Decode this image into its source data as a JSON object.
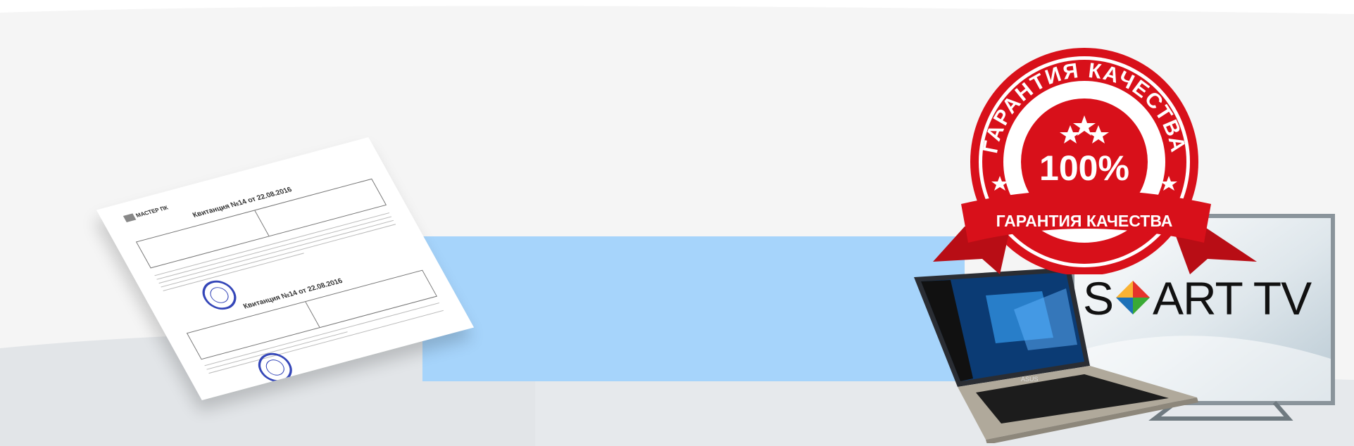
{
  "receipt": {
    "logo": "МАСТЕР ПК",
    "title1": "Квитанция №14 от 22.08.2016",
    "title2": "Квитанция №14 от 22.08.2016"
  },
  "seal": {
    "top_ring": "ГАРАНТИЯ КАЧЕСТВА",
    "percent": "100%",
    "ribbon": "ГАРАНТИЯ КАЧЕСТВА"
  },
  "tv": {
    "brand_left": "S",
    "brand_right": "ART TV"
  },
  "laptop": {
    "brand": "ASUS"
  },
  "colors": {
    "background": "#f4f4f4",
    "band": "#a6d4fb",
    "seal_red": "#d8101a",
    "stamp_blue": "#3446b8"
  }
}
